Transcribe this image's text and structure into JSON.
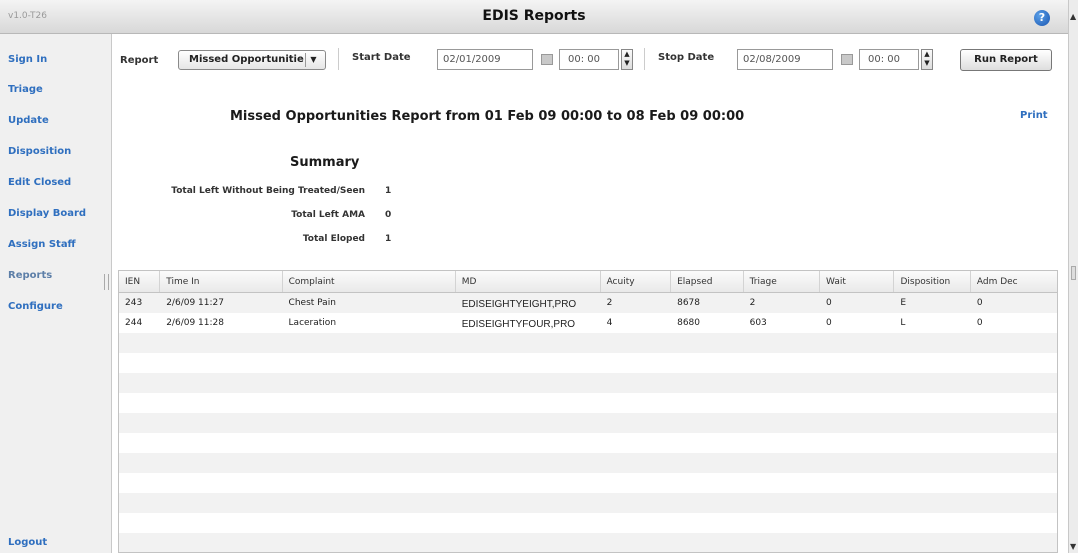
{
  "window": {
    "version": "v1.0-T26",
    "title": "EDIS Reports",
    "help_icon": "help-icon"
  },
  "sidebar": {
    "items": [
      {
        "label": "Sign In"
      },
      {
        "label": "Triage"
      },
      {
        "label": "Update"
      },
      {
        "label": "Disposition"
      },
      {
        "label": "Edit Closed"
      },
      {
        "label": "Display Board"
      },
      {
        "label": "Assign Staff"
      },
      {
        "label": "Reports"
      },
      {
        "label": "Configure"
      }
    ],
    "logout": "Logout",
    "active_item": "Reports"
  },
  "toolbar": {
    "report_label": "Report",
    "report_value": "Missed Opportunitie",
    "start_label": "Start Date",
    "start_date": "02/01/2009",
    "start_time": "00: 00",
    "stop_label": "Stop Date",
    "stop_date": "02/08/2009",
    "stop_time": "00: 00",
    "run_button": "Run Report"
  },
  "report": {
    "title": "Missed Opportunities Report from 01 Feb 09 00:00 to 08 Feb 09 00:00",
    "print": "Print",
    "summary_title": "Summary",
    "summary": [
      {
        "label": "Total Left Without Being Treated/Seen",
        "value": "1"
      },
      {
        "label": "Total Left AMA",
        "value": "0"
      },
      {
        "label": "Total Eloped",
        "value": "1"
      }
    ]
  },
  "table": {
    "columns": [
      "IEN",
      "Time In",
      "Complaint",
      "MD",
      "Acuity",
      "Elapsed",
      "Triage",
      "Wait",
      "Disposition",
      "Adm Dec"
    ],
    "rows": [
      [
        "243",
        "2/6/09 11:27",
        "Chest Pain",
        "EDISEIGHTYEIGHT,PRO",
        "2",
        "8678",
        "2",
        "0",
        "E",
        "0"
      ],
      [
        "244",
        "2/6/09 11:28",
        "Laceration",
        "EDISEIGHTYFOUR,PRO",
        "4",
        "8680",
        "603",
        "0",
        "L",
        "0"
      ]
    ]
  },
  "colors": {
    "link": "#2f6fbf",
    "titlebar": "#e2e2e2",
    "row_alt": "#f2f2f2"
  }
}
